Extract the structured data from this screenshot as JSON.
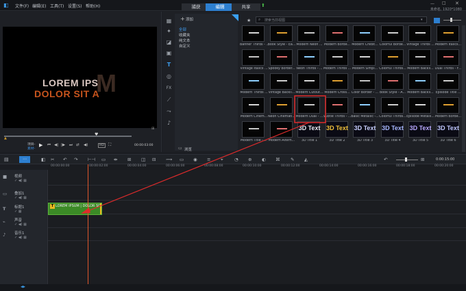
{
  "menu": {
    "file": "文件(F)",
    "edit": "编辑(E)",
    "tools": "工具(T)",
    "settings": "设置(S)",
    "help": "帮助(H)"
  },
  "tabs": {
    "capture": "捕获",
    "edit": "编辑",
    "share": "共享"
  },
  "window_title": "未命名, 1920*1080",
  "preview": {
    "line1": "LOREM IPS",
    "line2": "DOLOR SIT A",
    "ghost": "M",
    "project_label": "项目-",
    "clip_label": "素材-",
    "timecode": "00:00:03:00"
  },
  "library": {
    "add_label": "添加",
    "search_placeholder": "搜索当前视图",
    "folders": [
      "全部",
      "收藏夹",
      "纯文本",
      "自定义"
    ],
    "browse_label": "浏览",
    "thumbs": [
      "Banner Thirds - ...",
      "Book Style - Ea...",
      "Modern Neon ...",
      "Modern Borde...",
      "Modern Credit...",
      "Colorful Borde...",
      "Vintage Thirds ...",
      "Modern Italics...",
      "Vintage Italics ...",
      "Spooky Border...",
      "Neon Thirds - ...",
      "Modern Thirds ...",
      "Modern Simpl...",
      "Colorful Thirds...",
      "Modern Backli...",
      "Dual Thirds - F...",
      "Modern Thirds ...",
      "Vintage Backli...",
      "Modern Cutout...",
      "Modern Cross...",
      "Color Border - ...",
      "Book Style - A...",
      "Modern Backli...",
      "Episode Title ...",
      "Modern Cinem...",
      "Neon Cinemati...",
      "Modern Dual - ...",
      "Subtle Thirds - ...",
      "Basic Metallic -...",
      "Colorful Thirds...",
      "Episode Metalli...",
      "Modern Borde...",
      "Modern Title - ...",
      "Modern Altern...",
      "3D Title 1",
      "3D Title 2",
      "3D Title 3",
      "3D Title 4",
      "3D Title 5",
      "3D Title 6"
    ]
  },
  "timeline": {
    "ruler": [
      "00:00:00:00",
      "00:00:02:00",
      "00:00:04:00",
      "00:00:06:00",
      "00:00:08:00",
      "00:00:10:00",
      "00:00:12:00",
      "00:00:14:00",
      "00:00:16:00",
      "00:00:18:00",
      "00:00:20:00"
    ],
    "timecode": "0:00:15:00",
    "tracks": [
      "视频",
      "叠加1",
      "标题1",
      "声音",
      "音乐1"
    ],
    "clip_label": "LOREM IPSUM | DOLOR SIT"
  },
  "colors": {
    "accent": "#2d7fd0",
    "highlight_box": "#e02b2b",
    "clip": "#3b8a26",
    "playhead": "#e0572b"
  }
}
